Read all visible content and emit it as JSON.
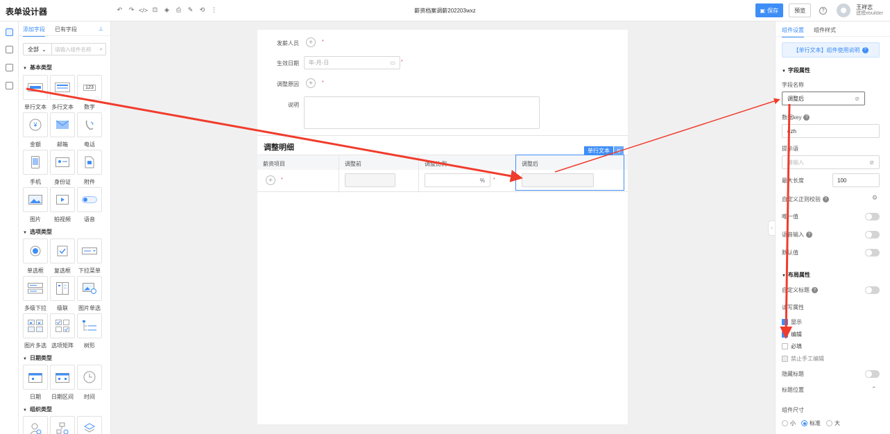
{
  "header": {
    "app_title": "表单设计器",
    "doc_title": "薪资档案调薪202203wxz",
    "save_label": "保存",
    "preview_label": "预览",
    "user_name": "王祥志",
    "user_org": "建模ebuilder"
  },
  "panel": {
    "tabs": [
      "添加字段",
      "已有字段"
    ],
    "category": "全部",
    "search_placeholder": "请输入组件名称",
    "sections": [
      "基本类型",
      "选项类型",
      "日期类型",
      "组织类型"
    ],
    "basic": [
      "单行文本",
      "多行文本",
      "数字",
      "金额",
      "邮箱",
      "电话",
      "手机",
      "身份证",
      "附件",
      "图片",
      "拍视频",
      "语音"
    ],
    "option": [
      "单选框",
      "复选框",
      "下拉菜单",
      "多级下拉",
      "级联",
      "图片单选",
      "图片多选",
      "选项矩阵",
      "树形"
    ],
    "date": [
      "日期",
      "日期区间",
      "时间"
    ],
    "number_icon_text": "123"
  },
  "canvas": {
    "issuer_label": "发薪人员",
    "effective_date_label": "生效日期",
    "date_placeholder": "年-月-日",
    "reason_label": "调整原因",
    "desc_label": "说明",
    "detail_title": "调整明细",
    "columns": [
      "薪资项目",
      "调整前",
      "调整比例",
      "调整后"
    ],
    "pct_symbol": "%",
    "component_tag": "单行文本"
  },
  "rpanel": {
    "tabs": [
      "组件设置",
      "组件样式"
    ],
    "usage_link": "【单行文本】组件使用说明",
    "field_props": "字段属性",
    "field_name_label": "字段名称",
    "field_name_value": "调整后",
    "data_key_label": "数据key",
    "data_key_value": "dzh",
    "hint_label": "提示语",
    "hint_placeholder": "请输入",
    "max_len_label": "最大长度",
    "max_len_value": "100",
    "regex_label": "自定义正则校验",
    "unique_label": "唯一值",
    "voice_label": "语音输入",
    "default_label": "默认值",
    "layout_props": "布局属性",
    "custom_title_label": "自定义标题",
    "rw_label": "读写属性",
    "show_label": "显示",
    "edit_label": "编辑",
    "required_label": "必填",
    "no_manual_label": "禁止手工编辑",
    "hide_title_label": "隐藏标题",
    "title_pos_label": "标题位置",
    "size_label": "组件尺寸",
    "size_options": [
      "小",
      "标准",
      "大"
    ],
    "size_selected": "标准"
  },
  "colors": {
    "accent": "#3e8ef7",
    "annotation": "#f03c2c"
  }
}
